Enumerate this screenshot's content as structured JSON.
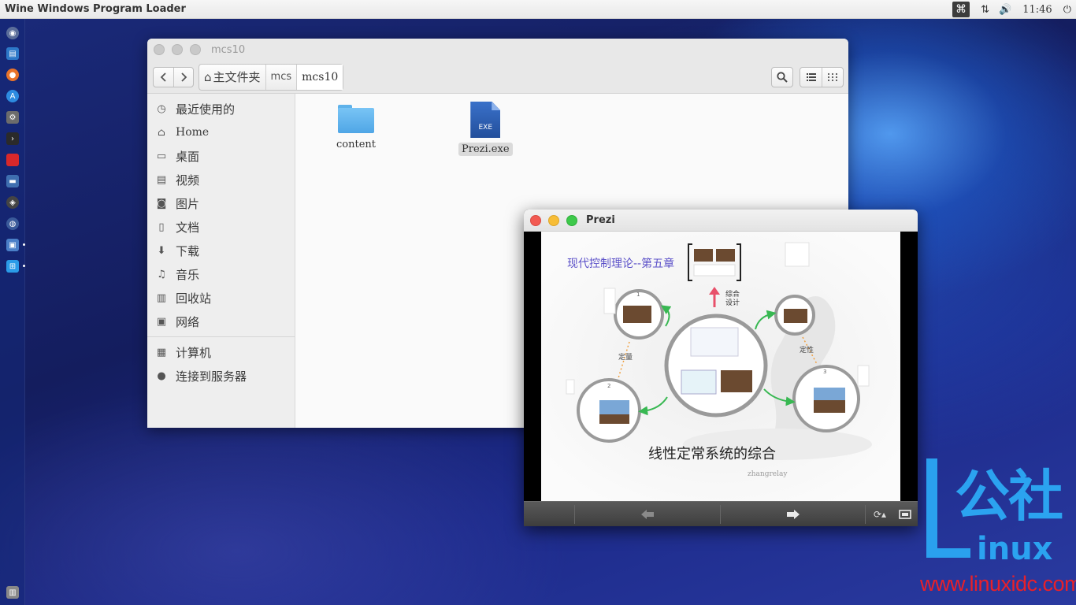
{
  "top_panel": {
    "app_title": "Wine Windows Program Loader",
    "tray": {
      "cmd_glyph": "⌘",
      "network_glyph": "⇅",
      "volume_glyph": "🔊",
      "clock": "11:46",
      "power_glyph": "⏻"
    }
  },
  "launcher": {
    "items": [
      {
        "name": "dash-home-icon",
        "color": "#5b6e9a"
      },
      {
        "name": "files-icon",
        "color": "#2d78c8"
      },
      {
        "name": "firefox-icon",
        "color": "#e8732a"
      },
      {
        "name": "app-store-icon",
        "color": "#2d8be0"
      },
      {
        "name": "settings-icon",
        "color": "#6c6c6c"
      },
      {
        "name": "terminal-icon",
        "color": "#2a2a2a"
      },
      {
        "name": "red-app-icon",
        "color": "#d8282a"
      },
      {
        "name": "remote-desktop-icon",
        "color": "#3f6fb0"
      },
      {
        "name": "compass-icon",
        "color": "#444"
      },
      {
        "name": "globe-icon",
        "color": "#3a5a9a"
      },
      {
        "name": "network-app-icon",
        "color": "#4a7fc8"
      },
      {
        "name": "windows-icon",
        "color": "#2a9be8"
      },
      {
        "name": "trash-icon",
        "color": "#888"
      }
    ]
  },
  "file_manager": {
    "title": "mcs10",
    "breadcrumb": {
      "home": "主文件夹",
      "crumb1": "mcs",
      "crumb2": "mcs10"
    },
    "sidebar": [
      {
        "label": "最近使用的",
        "icon": "clock-icon",
        "glyph": "◷"
      },
      {
        "label": "Home",
        "icon": "home-icon",
        "glyph": "⌂"
      },
      {
        "label": "桌面",
        "icon": "desktop-icon",
        "glyph": "▭"
      },
      {
        "label": "视频",
        "icon": "video-icon",
        "glyph": "▤"
      },
      {
        "label": "图片",
        "icon": "camera-icon",
        "glyph": "◙"
      },
      {
        "label": "文档",
        "icon": "document-icon",
        "glyph": "▯"
      },
      {
        "label": "下载",
        "icon": "download-icon",
        "glyph": "⬇"
      },
      {
        "label": "音乐",
        "icon": "headphones-icon",
        "glyph": "♫"
      },
      {
        "label": "回收站",
        "icon": "trash-icon",
        "glyph": "▥"
      },
      {
        "label": "网络",
        "icon": "network-icon",
        "glyph": "▣"
      },
      {
        "label": "计算机",
        "icon": "computer-icon",
        "glyph": "▦"
      },
      {
        "label": "连接到服务器",
        "icon": "server-icon",
        "glyph": "●"
      }
    ],
    "files": [
      {
        "label": "content",
        "type": "folder"
      },
      {
        "label": "Prezi.exe",
        "type": "exe",
        "ext": "EXE"
      }
    ]
  },
  "prezi": {
    "title": "Prezi",
    "slide": {
      "header": "现代控制理论--第五章",
      "main_title": "线性定常系统的综合",
      "author": "zhangrelay",
      "label_top": "综合设计",
      "label_top1": "综合",
      "label_top2": "设计",
      "label_left": "定量",
      "label_right": "定性",
      "num1": "1",
      "num2": "2",
      "num3": "3"
    },
    "controls": {
      "prev_glyph": "⬅",
      "next_glyph": "➡",
      "autoplay_glyph": "⟳▴",
      "fullscreen_glyph": "⛶"
    }
  },
  "watermark": {
    "cn": "公社",
    "linux": "inux",
    "url": "www.linuxidc.com"
  }
}
